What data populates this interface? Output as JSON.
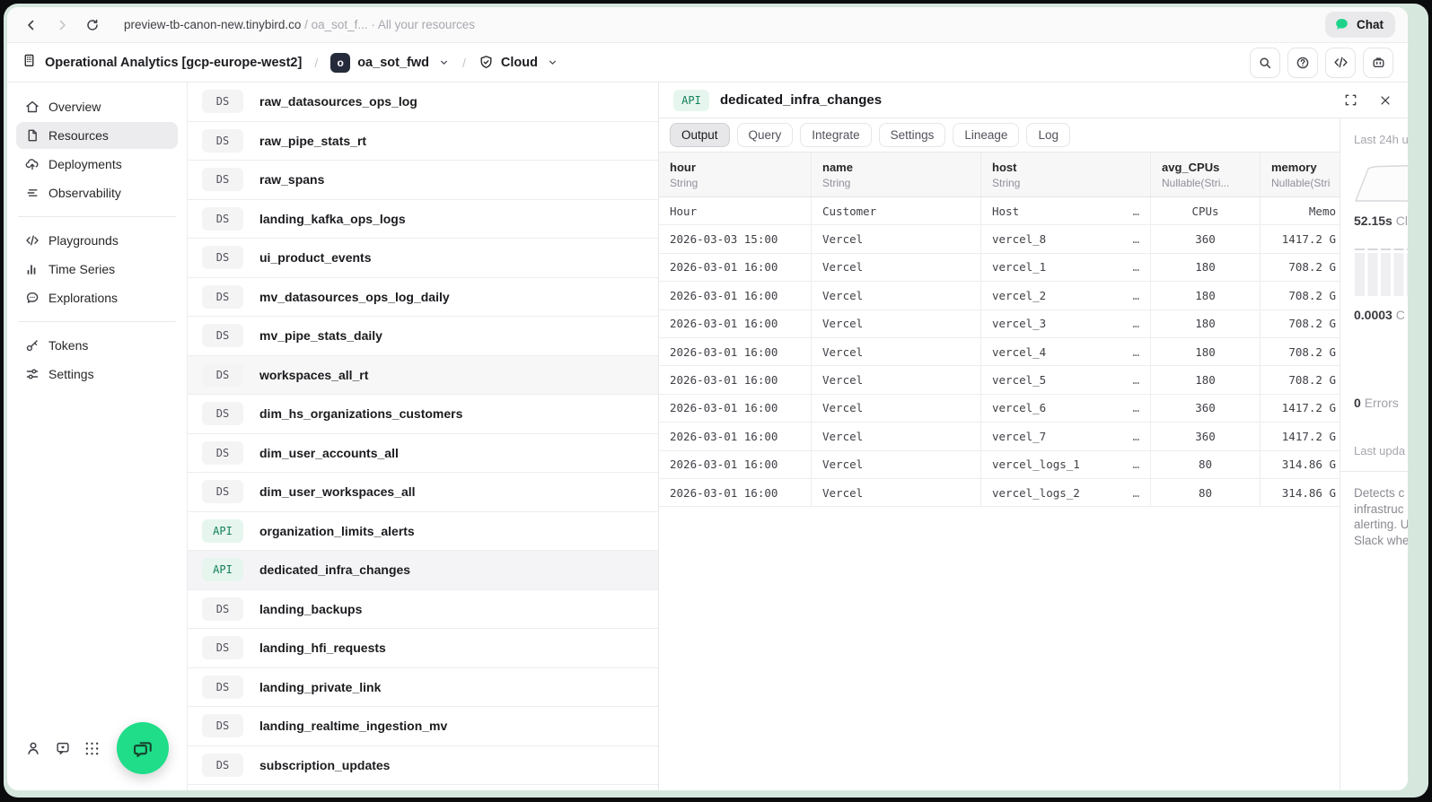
{
  "colors": {
    "accent_green": "#1fdd88",
    "mint_frame": "#d6e7dd",
    "api_badge_bg": "#e6f6ee",
    "api_badge_text": "#12805c",
    "ds_badge_bg": "#f4f4f5"
  },
  "browser_bar": {
    "url_primary": "preview-tb-canon-new.tinybird.co",
    "url_secondary": " / oa_sot_f... · All your resources",
    "chat_button": "Chat"
  },
  "app_header": {
    "org_name": "Operational Analytics [gcp-europe-west2]",
    "separator": "/",
    "workspace_badge": "o",
    "workspace_name": "oa_sot_fwd",
    "environment": "Cloud"
  },
  "sidebar": {
    "groups": [
      {
        "items": [
          {
            "icon": "home-icon",
            "label": "Overview"
          },
          {
            "icon": "file-icon",
            "label": "Resources",
            "active": true
          },
          {
            "icon": "cloud-upload-icon",
            "label": "Deployments"
          },
          {
            "icon": "observability-icon",
            "label": "Observability"
          }
        ]
      },
      {
        "items": [
          {
            "icon": "code-icon",
            "label": "Playgrounds"
          },
          {
            "icon": "bar-chart-icon",
            "label": "Time Series"
          },
          {
            "icon": "message-icon",
            "label": "Explorations"
          }
        ]
      },
      {
        "items": [
          {
            "icon": "key-icon",
            "label": "Tokens"
          },
          {
            "icon": "sliders-icon",
            "label": "Settings"
          }
        ]
      }
    ]
  },
  "resource_list": {
    "items": [
      {
        "type": "DS",
        "name": "raw_datasources_ops_log"
      },
      {
        "type": "DS",
        "name": "raw_pipe_stats_rt"
      },
      {
        "type": "DS",
        "name": "raw_spans"
      },
      {
        "type": "DS",
        "name": "landing_kafka_ops_logs"
      },
      {
        "type": "DS",
        "name": "ui_product_events"
      },
      {
        "type": "DS",
        "name": "mv_datasources_ops_log_daily"
      },
      {
        "type": "DS",
        "name": "mv_pipe_stats_daily"
      },
      {
        "type": "DS",
        "name": "workspaces_all_rt",
        "highlight": true
      },
      {
        "type": "DS",
        "name": "dim_hs_organizations_customers"
      },
      {
        "type": "DS",
        "name": "dim_user_accounts_all"
      },
      {
        "type": "DS",
        "name": "dim_user_workspaces_all"
      },
      {
        "type": "API",
        "name": "organization_limits_alerts"
      },
      {
        "type": "API",
        "name": "dedicated_infra_changes",
        "selected": true
      },
      {
        "type": "DS",
        "name": "landing_backups"
      },
      {
        "type": "DS",
        "name": "landing_hfi_requests"
      },
      {
        "type": "DS",
        "name": "landing_private_link"
      },
      {
        "type": "DS",
        "name": "landing_realtime_ingestion_mv"
      },
      {
        "type": "DS",
        "name": "subscription_updates"
      }
    ]
  },
  "detail_panel": {
    "badge": "API",
    "title": "dedicated_infra_changes",
    "tabs": [
      {
        "label": "Output",
        "active": true
      },
      {
        "label": "Query"
      },
      {
        "label": "Integrate"
      },
      {
        "label": "Settings"
      },
      {
        "label": "Lineage"
      },
      {
        "label": "Log"
      }
    ],
    "table": {
      "row_ellipsis": "…",
      "columns": [
        {
          "name": "hour",
          "type": "String"
        },
        {
          "name": "name",
          "type": "String"
        },
        {
          "name": "host",
          "type": "String"
        },
        {
          "name": "avg_CPUs",
          "type": "Nullable(Stri..."
        },
        {
          "name": "memory",
          "type": "Nullable(Stri"
        }
      ],
      "rows": [
        [
          "Hour",
          "Customer",
          "Host",
          "CPUs",
          "Memo"
        ],
        [
          "2026-03-03 15:00",
          "Vercel",
          "vercel_8",
          "360",
          "1417.2 G"
        ],
        [
          "2026-03-01 16:00",
          "Vercel",
          "vercel_1",
          "180",
          "708.2 G"
        ],
        [
          "2026-03-01 16:00",
          "Vercel",
          "vercel_2",
          "180",
          "708.2 G"
        ],
        [
          "2026-03-01 16:00",
          "Vercel",
          "vercel_3",
          "180",
          "708.2 G"
        ],
        [
          "2026-03-01 16:00",
          "Vercel",
          "vercel_4",
          "180",
          "708.2 G"
        ],
        [
          "2026-03-01 16:00",
          "Vercel",
          "vercel_5",
          "180",
          "708.2 G"
        ],
        [
          "2026-03-01 16:00",
          "Vercel",
          "vercel_6",
          "360",
          "1417.2 G"
        ],
        [
          "2026-03-01 16:00",
          "Vercel",
          "vercel_7",
          "360",
          "1417.2 G"
        ],
        [
          "2026-03-01 16:00",
          "Vercel",
          "vercel_logs_1",
          "80",
          "314.86 G"
        ],
        [
          "2026-03-01 16:00",
          "Vercel",
          "vercel_logs_2",
          "80",
          "314.86 G"
        ]
      ]
    }
  },
  "metrics_panel": {
    "period_label": "Last 24h u",
    "latency": {
      "value": "52.15s",
      "suffix": "Cl"
    },
    "cost": {
      "value": "0.0003",
      "suffix": "C"
    },
    "errors": {
      "value": "0",
      "suffix": "Errors"
    },
    "updated_label": "Last upda",
    "description_lines": [
      "Detects c",
      "infrastruc",
      "alerting. U",
      "Slack whe"
    ]
  }
}
